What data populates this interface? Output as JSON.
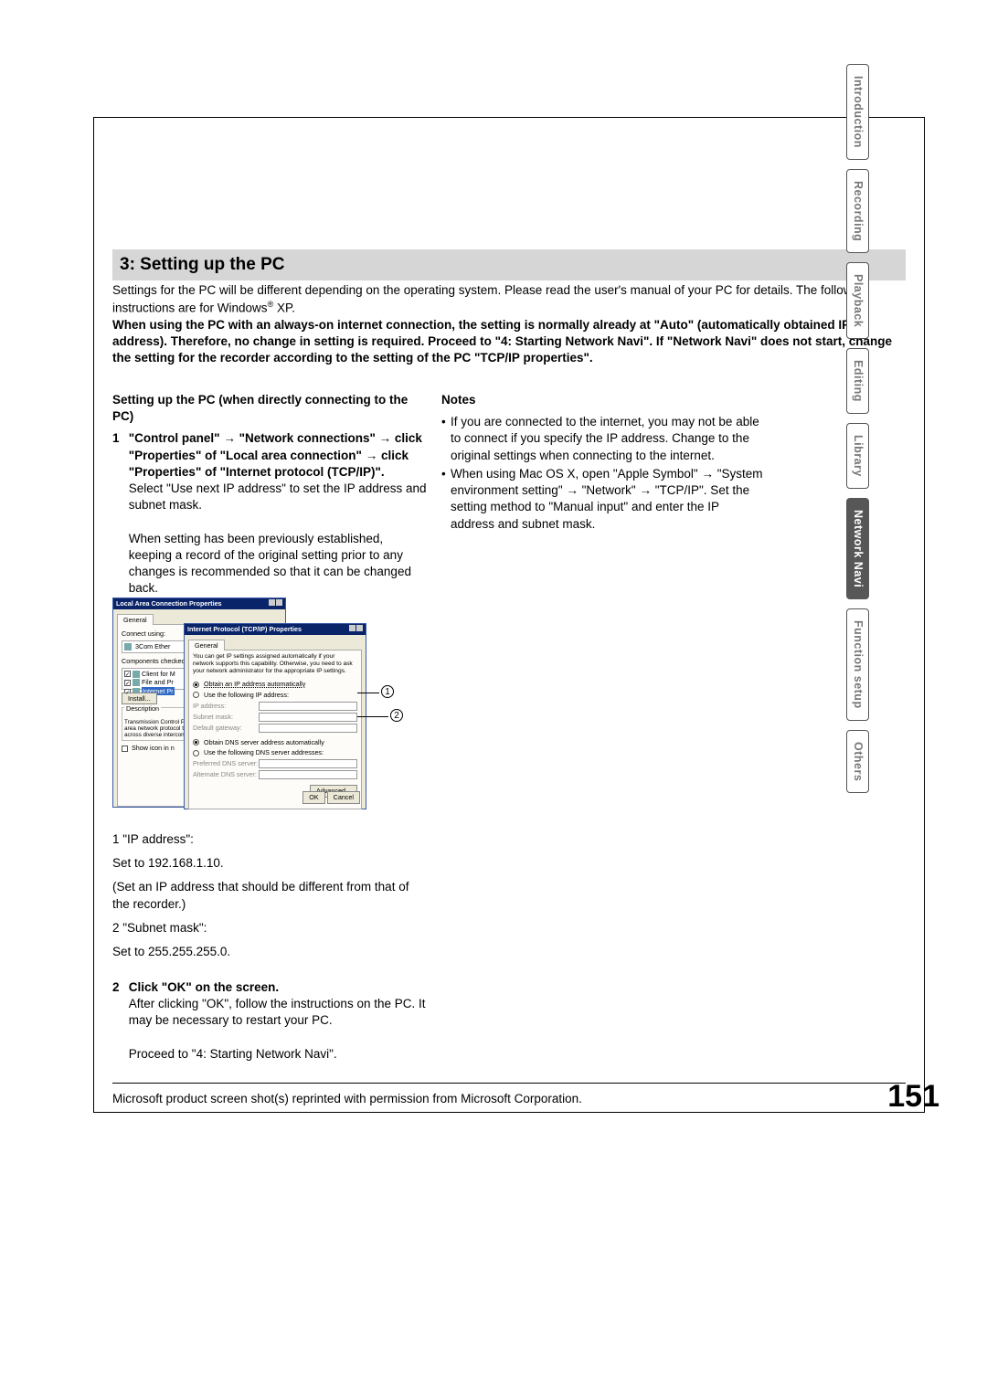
{
  "tabs": {
    "t0": "Introduction",
    "t1": "Recording",
    "t2": "Playback",
    "t3": "Editing",
    "t4": "Library",
    "t5": "Network Navi",
    "t6": "Function setup",
    "t7": "Others"
  },
  "heading": "3: Setting up the PC",
  "intro": {
    "p1a": "Settings for the PC will be different depending on the operating system. Please read the user's manual of your PC for details. The following instructions are for Windows",
    "reg": "®",
    "p1b": " XP.",
    "p2": "When using the PC with an always-on internet connection, the setting is normally already at \"Auto\" (automatically obtained IP address). Therefore, no change in setting is required.  Proceed to \"4: Starting Network Navi\". If \"Network Navi\" does not start, change the setting for the recorder according to the setting of the PC \"TCP/IP properties\"."
  },
  "left": {
    "sub": "Setting up the PC (when directly connecting to the PC)",
    "step1_num": "1",
    "step1_b1": "\"Control panel\" ",
    "arrow": "→",
    "step1_b2": " \"Network connections\" ",
    "step1_b3": " click \"Properties\" of \"Local area connection\" ",
    "step1_b4": " click \"Properties\" of \"Internet protocol (TCP/IP)\".",
    "step1_p1": "Select \"Use next IP address\" to set the IP address and subnet mask.",
    "step1_p2": "When setting has been previously established, keeping a record of the original setting prior to any changes is recommended so that it can be changed back.",
    "bf1": "1 \"IP address\":",
    "bf2": "Set to 192.168.1.10.",
    "bf3": "(Set an IP address that should be different from that of the recorder.)",
    "bf4": "2 \"Subnet mask\":",
    "bf5": "Set to 255.255.255.0.",
    "step2_num": "2",
    "step2_head": "Click \"OK\" on the screen.",
    "step2_p1": "After clicking \"OK\", follow the instructions on the PC. It may be necessary to restart your PC.",
    "step2_p2": "Proceed to \"4: Starting Network Navi\"."
  },
  "right": {
    "notes_head": "Notes",
    "n1": "If you are connected to the internet, you may not be able to connect if you specify the IP address. Change to the original settings when connecting to the internet.",
    "n2a": "When using Mac OS X, open \"Apple Symbol\" ",
    "arrow": "→",
    "n2b": " \"System environment setting\" ",
    "n2c": " \"Network\" ",
    "n2d": " \"TCP/IP\". Set the setting method to \"Manual input\" and enter the IP address and subnet mask."
  },
  "dialog": {
    "lac_title": "Local Area Connection Properties",
    "ip_title": "Internet Protocol (TCP/IP) Properties",
    "general_tab": "General",
    "connect_using": "Connect using:",
    "adapter": "3Com Ether",
    "comp_used": "Components checked are used by this connection:",
    "c1": "Client for M",
    "c2": "File and Pr",
    "c3": "Internet Pr",
    "install": "Install...",
    "desc_h": "Description",
    "desc_t": "Transmission Control Protocol/Internet Protocol. The wide area network protocol that provides communication across diverse interconnected networks.",
    "show_icon": "Show icon in n",
    "ip_desc": "You can get IP settings assigned automatically if your network supports this capability. Otherwise, you need to ask your network administrator for the appropriate IP settings.",
    "r_obtain_ip": "Obtain an IP address automatically",
    "r_use_ip": "Use the following IP address:",
    "l_ip": "IP address:",
    "l_mask": "Subnet mask:",
    "l_gw": "Default gateway:",
    "r_obtain_dns": "Obtain DNS server address automatically",
    "r_use_dns": "Use the following DNS server addresses:",
    "l_pdns": "Preferred DNS server:",
    "l_adns": "Alternate DNS server:",
    "advanced": "Advanced...",
    "ok": "OK",
    "cancel": "Cancel",
    "call1": "1",
    "call2": "2"
  },
  "permission": "Microsoft product screen shot(s) reprinted with permission from Microsoft Corporation.",
  "page_number": "151"
}
